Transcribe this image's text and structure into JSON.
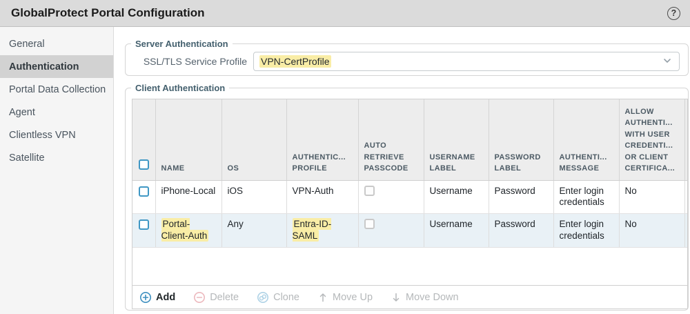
{
  "window": {
    "title": "GlobalProtect Portal Configuration",
    "help_icon": "?"
  },
  "sidebar": {
    "items": [
      {
        "label": "General",
        "selected": false
      },
      {
        "label": "Authentication",
        "selected": true
      },
      {
        "label": "Portal Data Collection",
        "selected": false
      },
      {
        "label": "Agent",
        "selected": false
      },
      {
        "label": "Clientless VPN",
        "selected": false
      },
      {
        "label": "Satellite",
        "selected": false
      }
    ]
  },
  "server_auth": {
    "legend": "Server Authentication",
    "field_label": "SSL/TLS Service Profile",
    "value": "VPN-CertProfile",
    "value_highlighted": true
  },
  "client_auth": {
    "legend": "Client Authentication",
    "table": {
      "columns": [
        "",
        "NAME",
        "OS",
        "AUTHENTIC...\nPROFILE",
        "AUTO\nRETRIEVE\nPASSCODE",
        "USERNAME\nLABEL",
        "PASSWORD\nLABEL",
        "AUTHENTI...\nMESSAGE",
        "ALLOW\nAUTHENTI...\nWITH USER\nCREDENTI...\nOR CLIENT\nCERTIFICA..."
      ],
      "rows": [
        {
          "selected": false,
          "name": "iPhone-Local",
          "os": "iOS",
          "auth_profile": "VPN-Auth",
          "auto_retrieve_passcode": false,
          "username_label": "Username",
          "password_label": "Password",
          "auth_message": "Enter login credentials",
          "allow_auth_with_cred_or_cert": "No",
          "highlighted": false
        },
        {
          "selected": false,
          "name": "Portal-Client-Auth",
          "os": "Any",
          "auth_profile": "Entra-ID-SAML",
          "auto_retrieve_passcode": false,
          "username_label": "Username",
          "password_label": "Password",
          "auth_message": "Enter login credentials",
          "allow_auth_with_cred_or_cert": "No",
          "highlighted": true
        }
      ]
    },
    "toolbar": {
      "add": "Add",
      "delete": "Delete",
      "clone": "Clone",
      "move_up": "Move Up",
      "move_down": "Move Down"
    }
  },
  "colors": {
    "search_highlight_yellow": "#f9eda6",
    "checkbox_accent_blue": "#3f97c4",
    "selected_row_blue": "#e9f1f6",
    "add_icon_blue": "#3d8fbf",
    "delete_icon_pink": "#ecb8bd",
    "clone_icon_lightblue": "#aed2e6"
  }
}
